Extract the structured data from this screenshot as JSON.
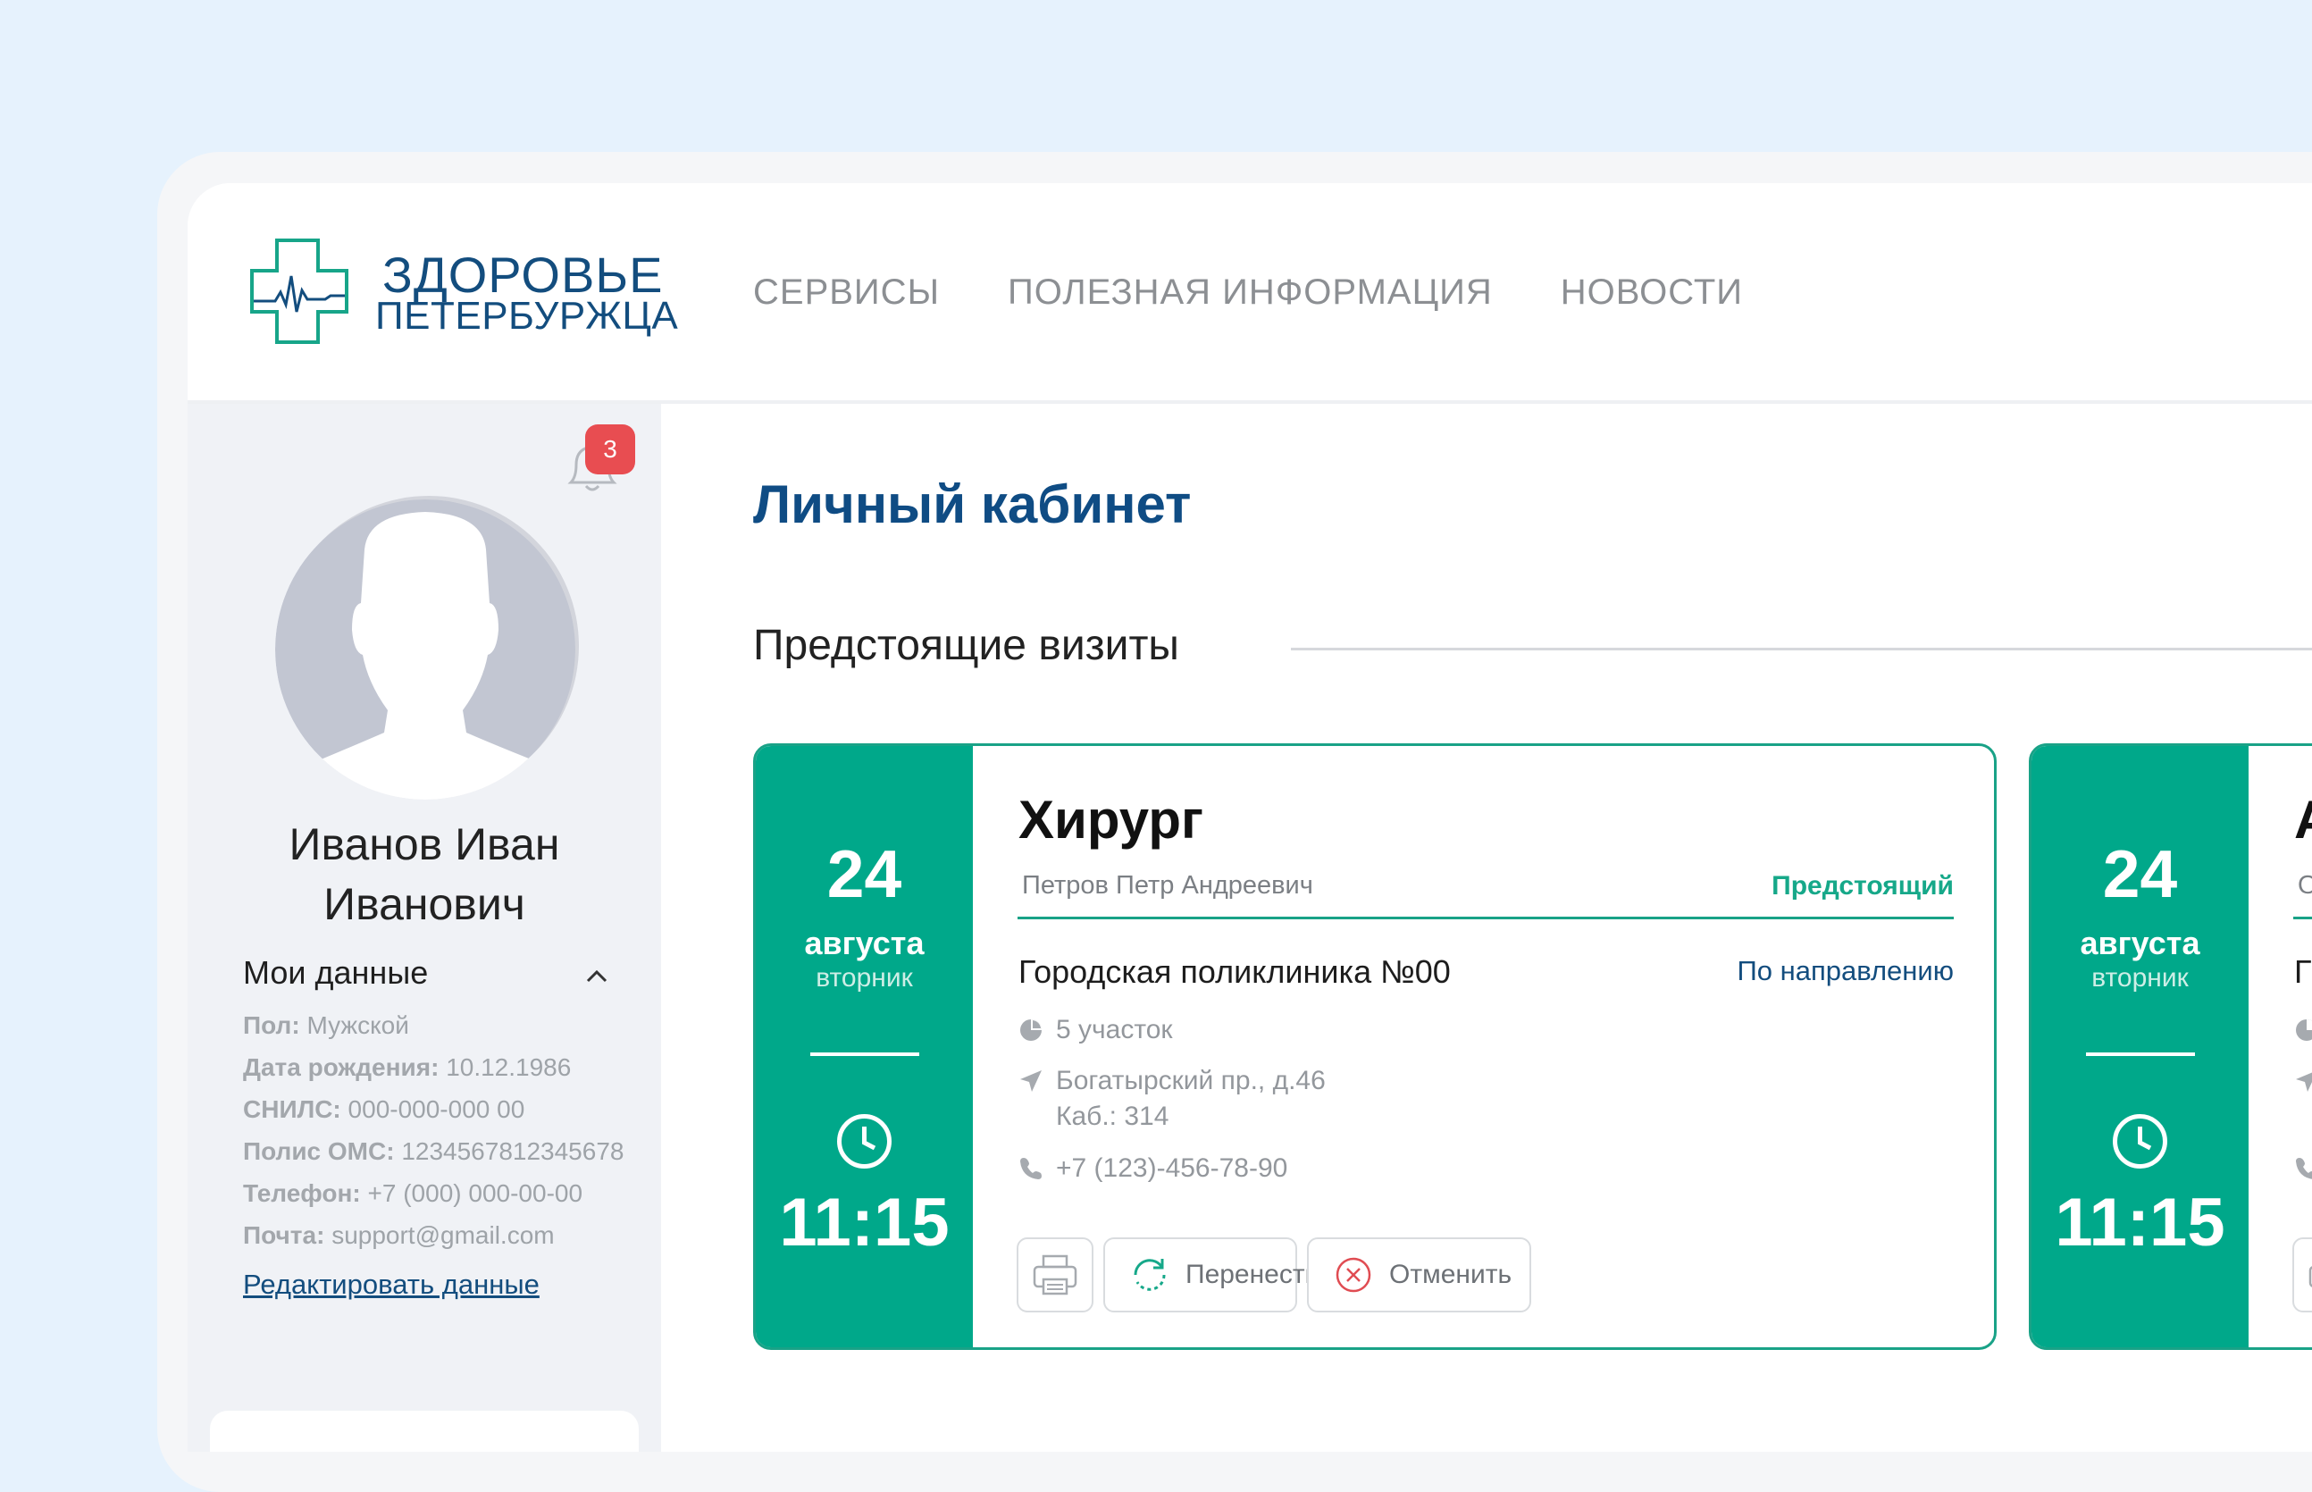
{
  "logo": {
    "line1": "ЗДОРОВЬЕ",
    "line2": "ПЕТЕРБУРЖЦА"
  },
  "nav": [
    "СЕРВИСЫ",
    "ПОЛЕЗНАЯ ИНФОРМАЦИЯ",
    "НОВОСТИ"
  ],
  "notifications": {
    "count": "3"
  },
  "user": {
    "name_line1": "Иванов Иван",
    "name_line2": "Иванович"
  },
  "my_data": {
    "title": "Мои данные",
    "fields": [
      {
        "label": "Пол:",
        "value": "Мужской"
      },
      {
        "label": "Дата рождения:",
        "value": "10.12.1986"
      },
      {
        "label": "СНИЛС:",
        "value": "000-000-000 00"
      },
      {
        "label": "Полис ОМС:",
        "value": "1234567812345678"
      },
      {
        "label": "Телефон:",
        "value": "+7 (000) 000-00-00"
      },
      {
        "label": "Почта:",
        "value": "support@gmail.com"
      }
    ],
    "edit_link": "Редактировать данные"
  },
  "main": {
    "page_title": "Личный кабинет",
    "section_title": "Предстоящие визиты"
  },
  "visits": [
    {
      "day": "24",
      "month": "августа",
      "weekday": "вторник",
      "time": "11:15",
      "specialty": "Хирург",
      "doctor": "Петров Петр Андреевич",
      "status": "Предстоящий",
      "clinic": "Городская поликлиника №00",
      "referral": "По направлению",
      "district": "5 участок",
      "address": "Богатырский пр., д.46",
      "room": "Каб.: 314",
      "phone": "+7 (123)-456-78-90",
      "move_label": "Перенести",
      "cancel_label": "Отменить"
    },
    {
      "day": "24",
      "month": "августа",
      "weekday": "вторник",
      "time": "11:15",
      "specialty": "А",
      "doctor": "О",
      "clinic": "Г"
    }
  ],
  "colors": {
    "accent": "#00a88a",
    "brand": "#134d7e",
    "badge": "#e84d51"
  }
}
